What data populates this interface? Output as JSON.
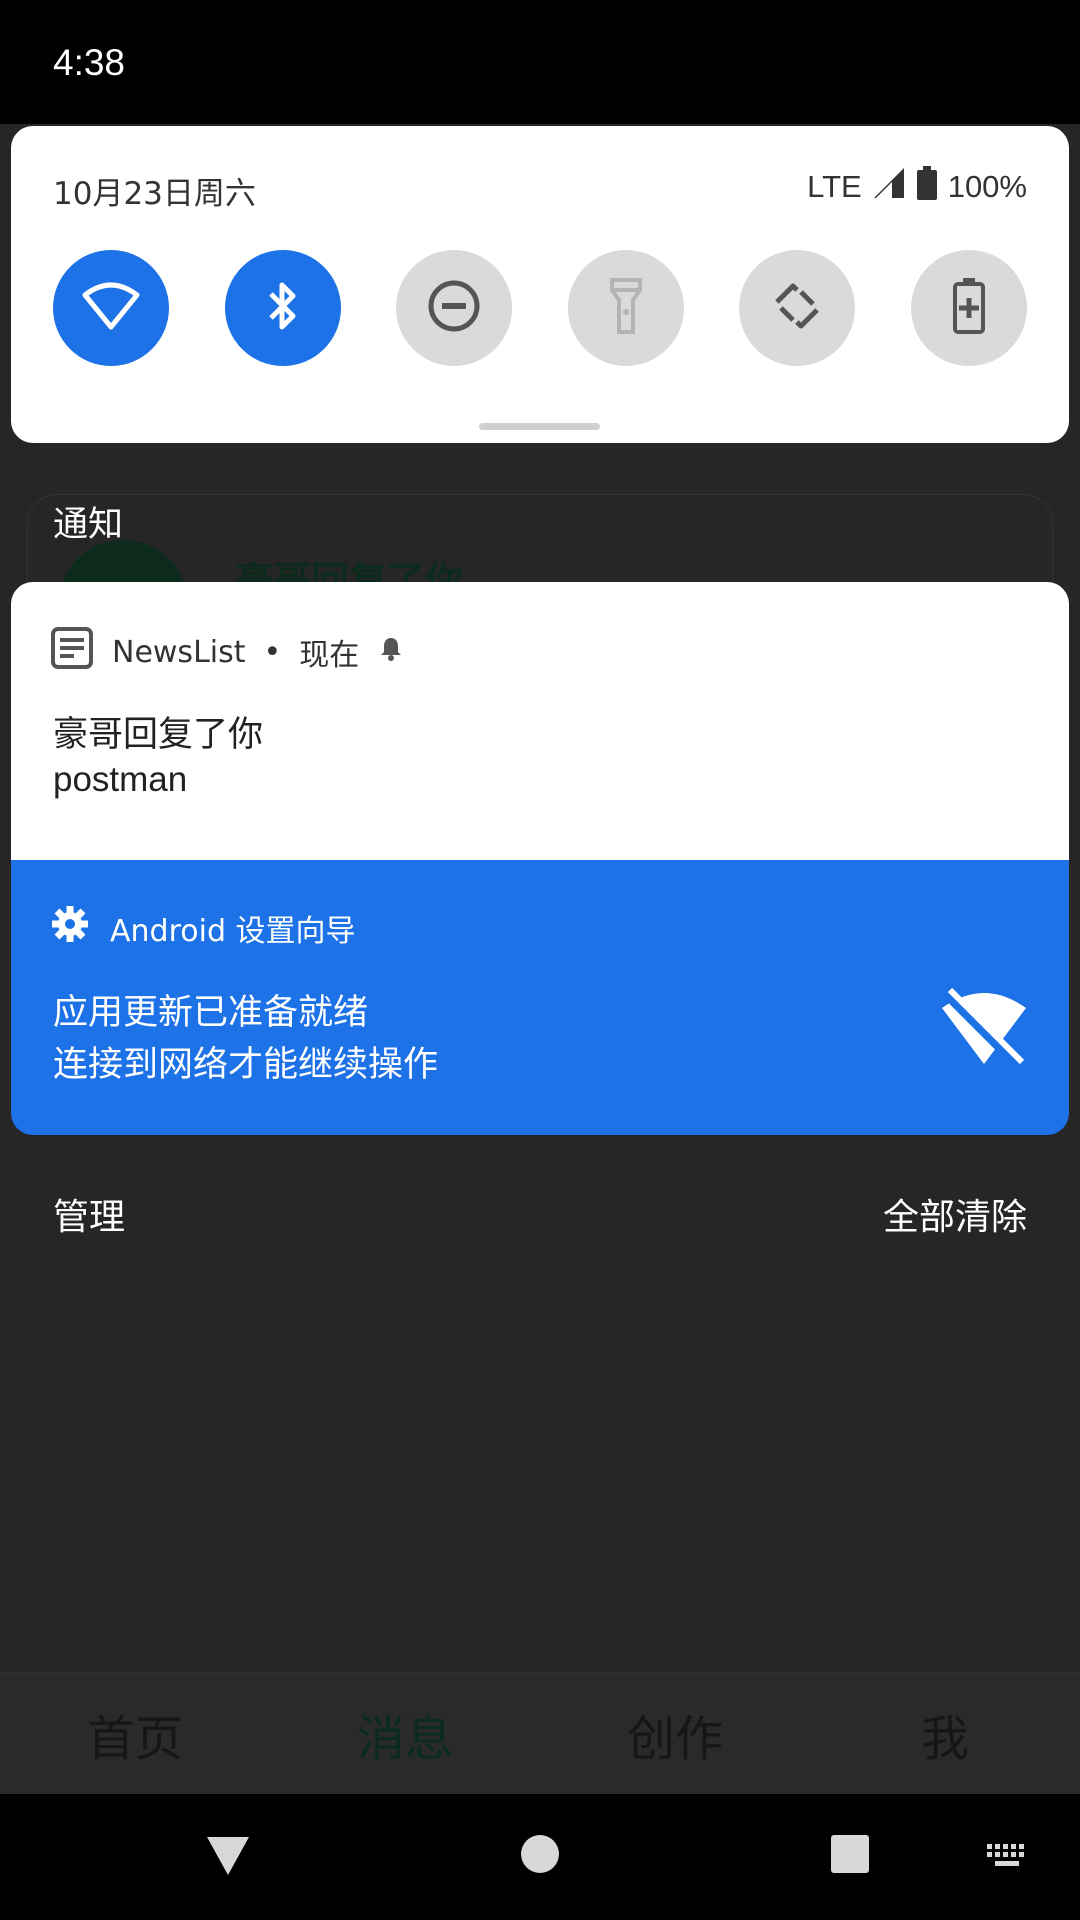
{
  "status_bar": {
    "time": "4:38"
  },
  "quick_settings": {
    "date": "10月23日周六",
    "network": "LTE",
    "battery_percent": "100%",
    "tiles": [
      {
        "name": "wifi",
        "state": "on"
      },
      {
        "name": "bluetooth",
        "state": "on"
      },
      {
        "name": "do-not-disturb",
        "state": "off"
      },
      {
        "name": "flashlight",
        "state": "off"
      },
      {
        "name": "auto-rotate",
        "state": "off"
      },
      {
        "name": "battery-saver",
        "state": "off"
      }
    ]
  },
  "notifications_section": {
    "title": "通知",
    "ghost_text": "豪哥回复了你"
  },
  "notification_1": {
    "app": "NewsList",
    "time": "现在",
    "title": "豪哥回复了你",
    "text": "postman",
    "icon": "news-app-icon"
  },
  "notification_2": {
    "app": "Android 设置向导",
    "line1": "应用更新已准备就绪",
    "line2": "连接到网络才能继续操作",
    "icon": "wifi-off-icon"
  },
  "footer": {
    "manage": "管理",
    "clear_all": "全部清除"
  },
  "bottom_tabs": [
    {
      "label": "首页"
    },
    {
      "label": "消息"
    },
    {
      "label": "创作"
    },
    {
      "label": "我"
    }
  ],
  "colors": {
    "accent": "#1c72e6",
    "tile_off": "#dadada",
    "shade_bg": "#262626"
  }
}
